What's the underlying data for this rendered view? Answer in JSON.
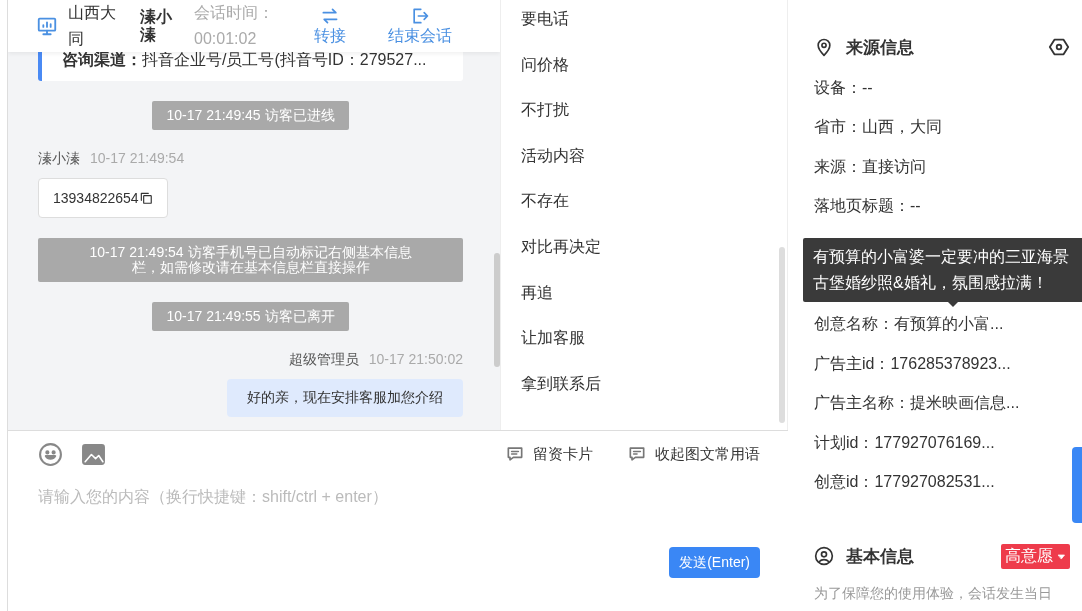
{
  "header": {
    "location": "山西大同",
    "visitor": "溱小溱",
    "session_time_label": "会话时间：",
    "session_time": "00:01:02",
    "actions": [
      {
        "kind": "transfer",
        "label": "转接"
      },
      {
        "kind": "end",
        "label": "结束会话"
      }
    ]
  },
  "channel_note": {
    "label": "咨询渠道：",
    "value": "抖音企业号/员工号(抖音号ID：279527..."
  },
  "messages": [
    {
      "kind": "system",
      "text": "10-17 21:49:45 访客已进线"
    },
    {
      "kind": "visitor",
      "sender": "溱小溱",
      "time": "10-17 21:49:54",
      "text": "13934822654"
    },
    {
      "kind": "system",
      "text": "10-17 21:49:54 访客手机号已自动标记右侧基本信息栏，如需修改请在基本信息栏直接操作"
    },
    {
      "kind": "system",
      "text": "10-17 21:49:55 访客已离开"
    },
    {
      "kind": "agent",
      "sender": "超级管理员",
      "time": "10-17 21:50:02",
      "text": "好的亲，现在安排客服加您介绍"
    }
  ],
  "quick_replies": [
    "要电话",
    "问价格",
    "不打扰",
    "活动内容",
    "不存在",
    "对比再决定",
    "再追",
    "让加客服",
    "拿到联系后"
  ],
  "composer": {
    "tools": [
      {
        "kind": "card",
        "label": "留资卡片"
      },
      {
        "kind": "phrases",
        "label": "收起图文常用语"
      }
    ],
    "placeholder": "请输入您的内容（换行快捷键：shift/ctrl + enter）",
    "send": "发送(Enter)"
  },
  "source_info": {
    "title": "来源信息",
    "fields": [
      "设备：--",
      "省市：山西，大同",
      "来源：直接访问",
      "落地页标题：--"
    ],
    "ad_fields": [
      "创意名称：有预算的小富...",
      "广告主id：176285378923...",
      "广告主名称：提米映画信息...",
      "计划id：177927076169...",
      "创意id：177927082531..."
    ]
  },
  "tooltip": {
    "lines": [
      "有预算的小富婆一定要冲的三亚海景",
      "古堡婚纱照&婚礼，氛围感拉满！"
    ]
  },
  "basic_info": {
    "title": "基本信息",
    "intent": "高意愿",
    "note": "为了保障您的使用体验，会话发生当日"
  }
}
